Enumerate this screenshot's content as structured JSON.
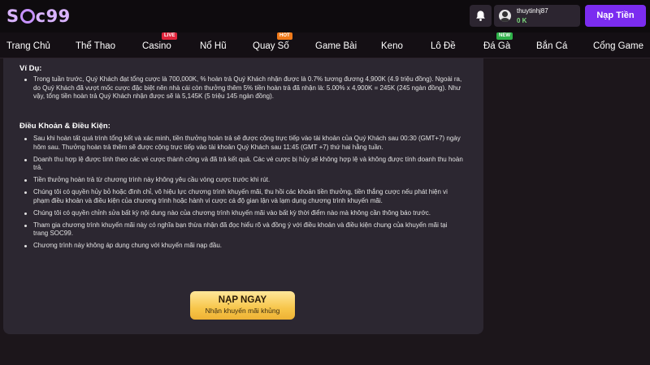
{
  "header": {
    "logo_text": "Soc99",
    "username": "thuytinhj87",
    "balance": "0 K",
    "deposit_label": "Nạp Tiền"
  },
  "nav": {
    "items": [
      {
        "label": "Trang Chủ"
      },
      {
        "label": "Thể Thao"
      },
      {
        "label": "Casino",
        "badge": "LIVE"
      },
      {
        "label": "Nổ Hũ"
      },
      {
        "label": "Quay Số",
        "badge": "HOT"
      },
      {
        "label": "Game Bài"
      },
      {
        "label": "Keno"
      },
      {
        "label": "Lô Đề"
      },
      {
        "label": "Đá Gà",
        "badge": "NEW"
      },
      {
        "label": "Bắn Cá"
      },
      {
        "label": "Cổng Game"
      }
    ]
  },
  "content": {
    "example_title": "Ví Dụ:",
    "example_items": [
      "Trong tuần trước, Quý Khách đạt tổng cược là 700,000K, % hoàn trả Quý Khách nhận được là 0.7% tương đương 4,900K (4.9 triệu đồng). Ngoài ra, do Quý Khách đã vượt mốc cược đặc biệt nên nhà cái còn thưởng thêm 5% tiền hoàn trả đã nhận là: 5.00% x 4,900K = 245K (245 ngàn đồng). Như vậy, tổng tiền hoàn trả Quý Khách nhận được sẽ là 5,145K (5 triệu 145 ngàn đồng)."
    ],
    "terms_title": "Điều Khoản & Điều Kiện:",
    "terms_items": [
      "Sau khi hoàn tất quá trình tổng kết và xác minh, tiền thưởng hoàn trả sẽ được cộng trực tiếp vào tài khoản của Quý Khách sau 00:30 (GMT+7) ngày hôm sau. Thưởng hoàn trả thêm sẽ được cộng trực tiếp vào tài khoản Quý Khách sau 11:45 (GMT +7) thứ hai hằng tuần.",
      "Doanh thu hợp lệ được tính theo các vé cược thành công và đã trả kết quả. Các vé cược bị hủy sẽ không hợp lệ và không được tính doanh thu hoàn trả.",
      "Tiền thưởng hoàn trả từ chương trình này không yêu cầu vòng cược trước khi rút.",
      "Chúng tôi có quyền hủy bỏ hoặc đình chỉ, vô hiệu lực chương trình khuyến mãi, thu hồi các khoản tiền thưởng, tiền thắng cược nếu phát hiện vi phạm điều khoản và điều kiện của chương trình hoặc hành vi cược cá độ gian lận và lạm dụng chương trình khuyến mãi.",
      "Chúng tôi có quyền chỉnh sửa bất kỳ nội dung nào của chương trình khuyến mãi vào bất kỳ thời điểm nào mà không cần thông báo trước.",
      "Tham gia chương trình khuyến mãi này có nghĩa bạn thừa nhận đã đọc hiểu rõ và đồng ý với điều khoản và điều kiện chung của khuyến mãi tại trang SOC99.",
      "Chương trình này không áp dụng chung với khuyến mãi nạp đầu."
    ],
    "cta_title": "NẠP NGAY",
    "cta_subtitle": "Nhận khuyến mãi khủng"
  },
  "colors": {
    "accent": "#7b2cf0",
    "panel": "#2c2731",
    "cta": "#f7c64b"
  },
  "icons": {
    "bell": "bell-icon",
    "avatar": "user-avatar-icon"
  }
}
